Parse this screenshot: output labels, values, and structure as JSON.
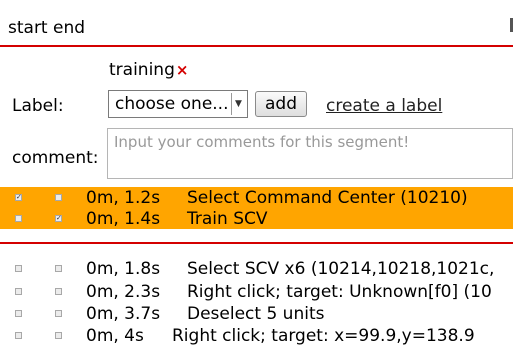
{
  "header": {
    "title": "start end"
  },
  "form": {
    "tag": {
      "text": "training",
      "remove_symbol": "×"
    },
    "label_caption": "Label:",
    "select_value": "choose one...",
    "select_arrow": "▼",
    "add_label": "add",
    "create_link": "create a label",
    "comment_caption": "comment:",
    "comment_placeholder": "Input your comments for this segment!"
  },
  "selected_rows": [
    {
      "check_a": true,
      "check_b": false,
      "time": "0m, 1.2s",
      "action": "Select Command Center (10210)"
    },
    {
      "check_a": false,
      "check_b": true,
      "time": "0m, 1.4s",
      "action": "Train SCV"
    }
  ],
  "rows": [
    {
      "check_a": false,
      "check_b": false,
      "time": "0m, 1.8s",
      "action": "Select SCV x6 (10214,10218,1021c,"
    },
    {
      "check_a": false,
      "check_b": false,
      "time": "0m, 2.3s",
      "action": "Right click; target: Unknown[f0] (10"
    },
    {
      "check_a": false,
      "check_b": false,
      "time": "0m, 3.7s",
      "action": "Deselect 5 units"
    },
    {
      "check_a": false,
      "check_b": false,
      "time": "0m, 4s",
      "action": "Right click; target: x=99.9,y=138.9"
    }
  ],
  "colors": {
    "highlight": "#ffa500",
    "divider": "#d40000"
  }
}
